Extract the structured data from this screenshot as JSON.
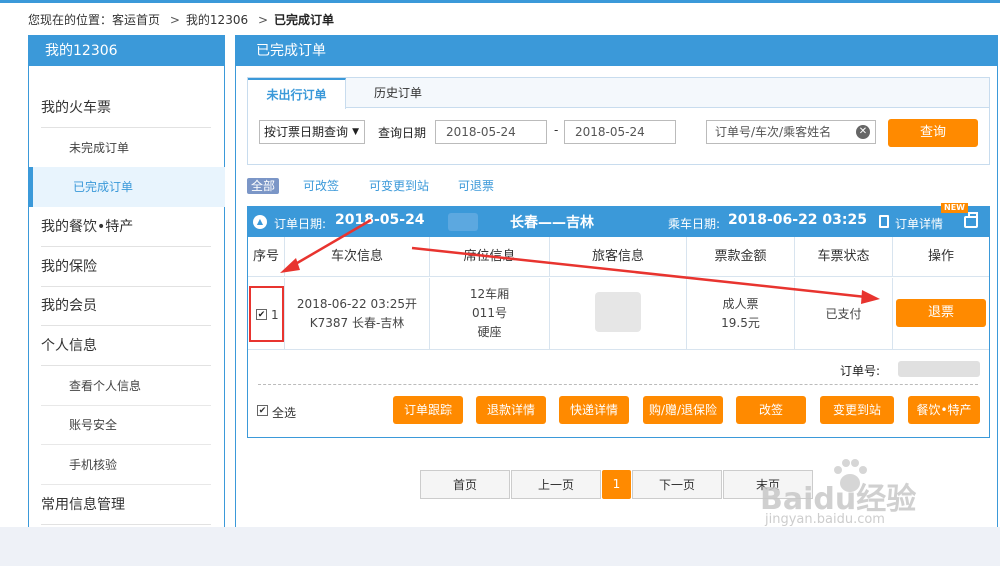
{
  "breadcrumb": {
    "prefix": "您现在的位置：",
    "home": "客运首页",
    "sep1": ">",
    "mine": "我的12306",
    "sep2": ">",
    "current": "已完成订单"
  },
  "sidebar": {
    "title": "我的12306",
    "groups": [
      {
        "label": "我的火车票"
      },
      {
        "label": "未完成订单"
      },
      {
        "label": "已完成订单"
      },
      {
        "label": "我的餐饮•特产"
      },
      {
        "label": "我的保险"
      },
      {
        "label": "我的会员"
      },
      {
        "label": "个人信息"
      },
      {
        "label": "查看个人信息"
      },
      {
        "label": "账号安全"
      },
      {
        "label": "手机核验"
      },
      {
        "label": "常用信息管理"
      }
    ]
  },
  "main": {
    "title": "已完成订单",
    "tabs": [
      {
        "label": "未出行订单"
      },
      {
        "label": "历史订单"
      }
    ],
    "search": {
      "mode": "按订票日期查询",
      "date_label": "查询日期",
      "start_date": "2018-05-24",
      "dash": "-",
      "end_date": "2018-05-24",
      "keyword_placeholder": "订单号/车次/乘客姓名",
      "query_button": "查询"
    },
    "filters": [
      "全部",
      "可改签",
      "可变更到站",
      "可退票"
    ],
    "order": {
      "order_date_label": "订单日期:",
      "order_date": "2018-05-24",
      "route": "长春——吉林",
      "ride_date_label": "乘车日期:",
      "ride_datetime": "2018-06-22 03:25",
      "detail_label": "订单详情",
      "new_badge": "NEW",
      "columns": [
        "序号",
        "车次信息",
        "席位信息",
        "旅客信息",
        "票款金额",
        "车票状态",
        "操作"
      ],
      "row": {
        "index": "1",
        "train_time": "2018-06-22 03:25开",
        "train_info": "K7387 长春-吉林",
        "car": "12车厢",
        "seat": "011号",
        "seat_type": "硬座",
        "ticket_type": "成人票",
        "price": "19.5元",
        "status": "已支付",
        "action": "退票"
      },
      "order_no_label": "订单号:",
      "select_all": "全选",
      "actions": [
        "订单跟踪",
        "退款详情",
        "快递详情",
        "购/赠/退保险",
        "改签",
        "变更到站",
        "餐饮•特产"
      ]
    },
    "pager": {
      "first": "首页",
      "prev": "上一页",
      "current": "1",
      "next": "下一页",
      "last": "末页"
    }
  },
  "watermark": {
    "brand": "Baidu经验",
    "url": "jingyan.baidu.com"
  },
  "colors": {
    "primary": "#3b99d9",
    "accent": "#ff8a00",
    "annotation": "#e8342f"
  }
}
